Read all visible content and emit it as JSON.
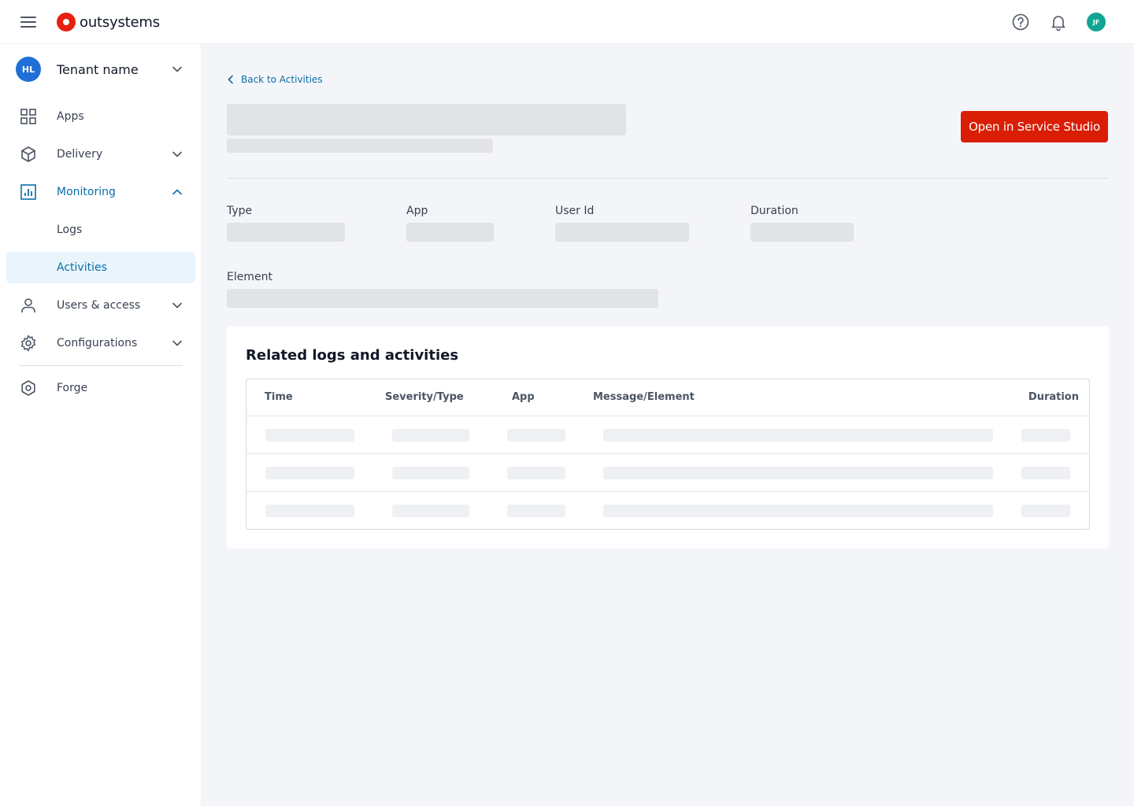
{
  "topbar": {
    "brand_name": "outsystems",
    "user_initials": "JF",
    "icons": [
      "menu-icon",
      "help-icon",
      "bell-icon"
    ]
  },
  "sidebar": {
    "tenant": {
      "initials": "HL",
      "name": "Tenant name"
    },
    "items": [
      {
        "label": "Apps",
        "icon": "apps-grid-icon"
      },
      {
        "label": "Delivery",
        "icon": "cube-icon"
      },
      {
        "label": "Monitoring",
        "icon": "chart-icon"
      },
      {
        "label": "Logs"
      },
      {
        "label": "Activities"
      },
      {
        "label": "Users & access",
        "icon": "user-icon"
      },
      {
        "label": "Configurations",
        "icon": "gear-icon"
      },
      {
        "label": "Forge",
        "icon": "forge-icon"
      }
    ],
    "colors": {
      "active": "#0b6ea8",
      "selected_bg": "#e9f4fc"
    }
  },
  "main": {
    "back_link": "Back to Activities",
    "open_button": "Open in Service Studio",
    "fields": {
      "type": "Type",
      "app": "App",
      "user_id": "User Id",
      "duration": "Duration",
      "element": "Element"
    },
    "related": {
      "title": "Related logs and activities",
      "columns": [
        "Time",
        "Severity/Type",
        "App",
        "Message/Element",
        "Duration"
      ]
    },
    "colors": {
      "brand": "#d91e05",
      "skeleton": "#e2e3e7"
    }
  }
}
